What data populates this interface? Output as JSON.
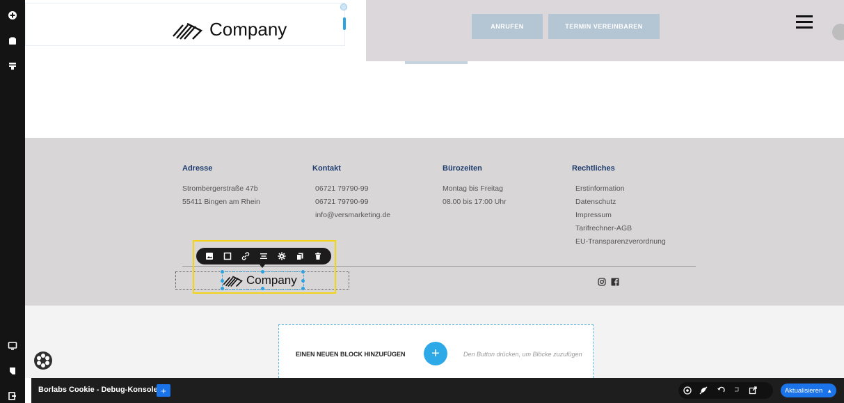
{
  "rail": {
    "top_icons": [
      "add-icon",
      "page-icon",
      "layout-icon"
    ],
    "bottom_icons": [
      "desktop-icon",
      "bookmark-icon",
      "exit-icon"
    ]
  },
  "header": {
    "logo_text": "Company",
    "buttons": [
      "ANRUFEN",
      "TERMIN VEREINBAREN"
    ],
    "menu_icon": "hamburger-icon"
  },
  "footer": {
    "columns": [
      {
        "heading": "Adresse",
        "lines": [
          "Strombergerstraße 47b",
          "55411 Bingen am Rhein"
        ]
      },
      {
        "heading": "Kontakt",
        "lines": [
          "06721 79790-99",
          "06721 79790-99",
          "info@versmarketing.de"
        ]
      },
      {
        "heading": "Bürozeiten",
        "lines": [
          "Montag bis Freitag",
          "08.00 bis 17:00 Uhr"
        ]
      },
      {
        "heading": "Rechtliches",
        "lines": [
          "Erstinformation",
          "Datenschutz",
          "Impressum",
          "Tarifrechner-AGB",
          "EU-Transparenzverordnung"
        ]
      }
    ],
    "logo_text": "Company",
    "toolbar_icons": [
      "image-icon",
      "square-icon",
      "link-icon",
      "align-icon",
      "gear-icon",
      "copy-icon",
      "trash-icon"
    ],
    "social_icons": [
      "instagram-icon",
      "facebook-icon"
    ]
  },
  "addblock": {
    "label": "EINEN NEUEN BLOCK HINZUFÜGEN",
    "plus": "+",
    "hint": "Den Button drücken, um Blöcke zuzufügen"
  },
  "debugbar": {
    "title": "Borlabs Cookie - Debug-Konsole",
    "plus": "+",
    "icons": [
      "help-icon",
      "disable-icon",
      "undo-icon",
      "redo-icon",
      "external-link-icon"
    ],
    "update_label": "Aktualisieren",
    "accent": "#1a73e8"
  }
}
